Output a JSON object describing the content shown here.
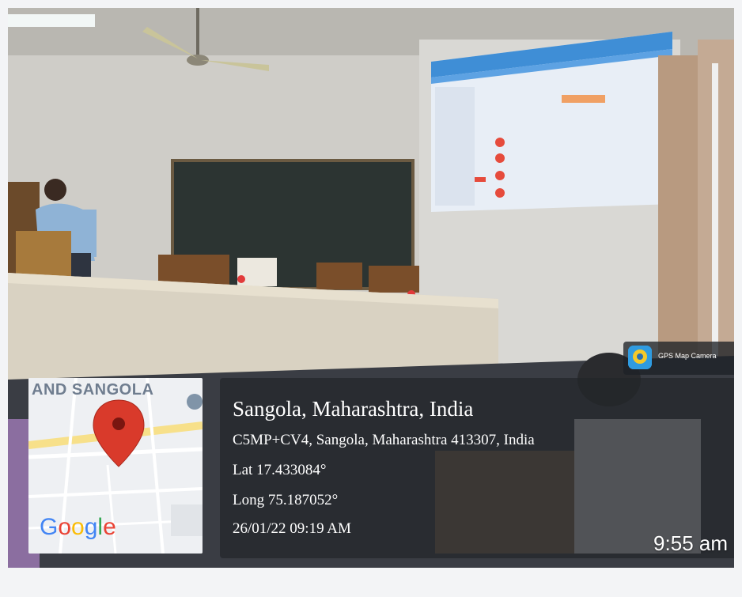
{
  "overlay": {
    "place_title": "Sangola, Maharashtra, India",
    "address": "C5MP+CV4, Sangola, Maharashtra 413307, India",
    "latitude": "Lat 17.433084°",
    "longitude": "Long 75.187052°",
    "datetime": "26/01/22 09:19 AM"
  },
  "map_thumbnail": {
    "area_label": "AND SANGOLA",
    "logo_text": "Google",
    "pin_color": "#d93a2b",
    "pin_icon": "map-pin-icon",
    "logo_colors": [
      "#4285f4",
      "#ea4335",
      "#fbbc05",
      "#4285f4",
      "#34a853",
      "#ea4335"
    ]
  },
  "app_badge": {
    "label": "GPS Map Camera",
    "icon": "gps-map-camera-icon"
  },
  "time_stamp": "9:55 am",
  "colors": {
    "wall": "#d6d4cf",
    "blackboard": "#2c3432",
    "projection": "#e8eef6",
    "panel": "rgba(35,38,42,0.72)"
  }
}
